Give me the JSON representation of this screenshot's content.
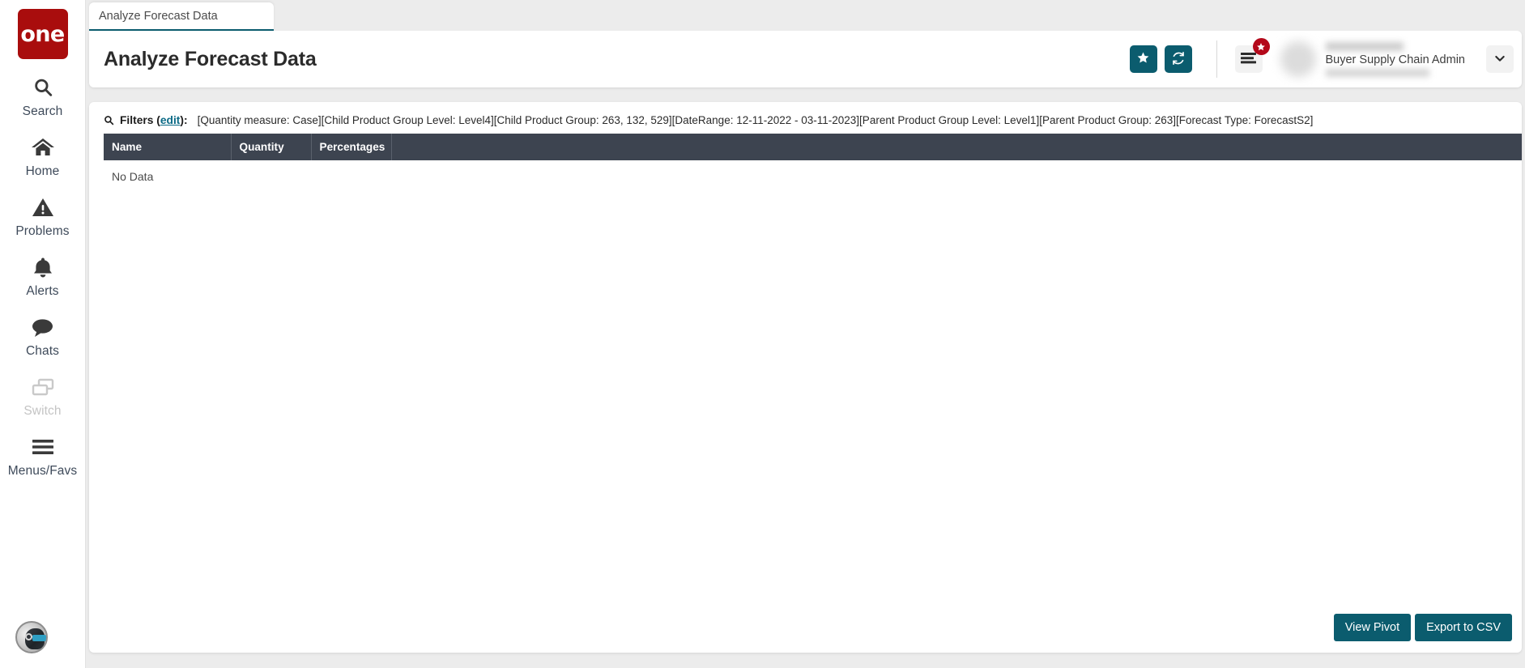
{
  "sidebar": {
    "logo_text": "one",
    "items": [
      {
        "label": "Search",
        "icon": "search-icon",
        "disabled": false
      },
      {
        "label": "Home",
        "icon": "home-icon",
        "disabled": false
      },
      {
        "label": "Problems",
        "icon": "warning-icon",
        "disabled": false
      },
      {
        "label": "Alerts",
        "icon": "bell-icon",
        "disabled": false
      },
      {
        "label": "Chats",
        "icon": "chat-icon",
        "disabled": false
      },
      {
        "label": "Switch",
        "icon": "switch-icon",
        "disabled": true
      },
      {
        "label": "Menus/Favs",
        "icon": "hamburger-icon",
        "disabled": false
      }
    ],
    "assistant_icon": "robot-avatar-icon"
  },
  "tabs": [
    {
      "label": "Analyze Forecast Data",
      "active": true
    }
  ],
  "header": {
    "title": "Analyze Forecast Data",
    "favorite_icon": "star-icon",
    "refresh_icon": "refresh-icon",
    "menu_icon": "hamburger-icon",
    "menu_badge_icon": "star-badge-icon",
    "avatar": "user-avatar",
    "user_role": "Buyer Supply Chain Admin",
    "caret_icon": "chevron-down-icon"
  },
  "filters": {
    "search_icon": "search-icon",
    "label": "Filters (",
    "edit_label": "edit",
    "label_end": "):",
    "value": "[Quantity measure: Case][Child Product Group Level: Level4][Child Product Group: 263, 132, 529][DateRange: 12-11-2022 - 03-11-2023][Parent Product Group Level: Level1][Parent Product Group: 263][Forecast Type: ForecastS2]"
  },
  "table": {
    "columns": [
      "Name",
      "Quantity",
      "Percentages",
      ""
    ],
    "rows": [],
    "empty_text": "No Data"
  },
  "footer": {
    "view_pivot_label": "View Pivot",
    "export_csv_label": "Export to CSV"
  },
  "colors": {
    "brand_red": "#a90d0d",
    "accent_teal": "#0b5c6e",
    "table_header": "#3d4450",
    "badge_red": "#b4091b",
    "page_bg": "#ececec"
  }
}
